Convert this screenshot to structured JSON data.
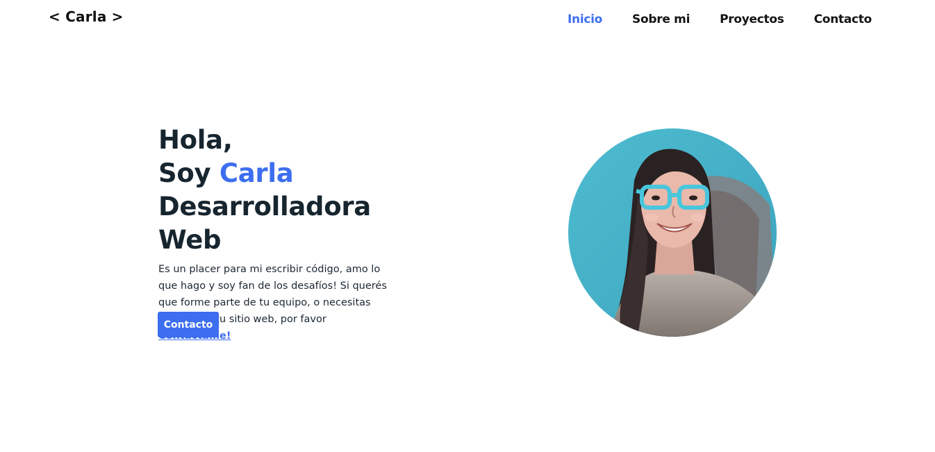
{
  "header": {
    "logo": "< Carla >",
    "nav": [
      {
        "label": "Inicio",
        "active": true
      },
      {
        "label": "Sobre mi",
        "active": false
      },
      {
        "label": "Proyectos",
        "active": false
      },
      {
        "label": "Contacto",
        "active": false
      }
    ]
  },
  "hero": {
    "greeting": "Hola,",
    "intro_prefix": "Soy ",
    "name": "Carla",
    "role": "Desarrolladora Web",
    "description": "Es un placer para mi escribir código, amo lo que hago y soy fan de los desafíos! Si querés que forme parte de tu equipo, o necesitas desarrollar tu sitio web, por favor ",
    "contact_link": "Contactame!",
    "button_label": "Contacto"
  },
  "avatar": {
    "semantic": "profile-photo"
  },
  "colors": {
    "accent": "#3d6ef0",
    "text": "#17252f",
    "avatar_bg": "#45b0c6"
  }
}
